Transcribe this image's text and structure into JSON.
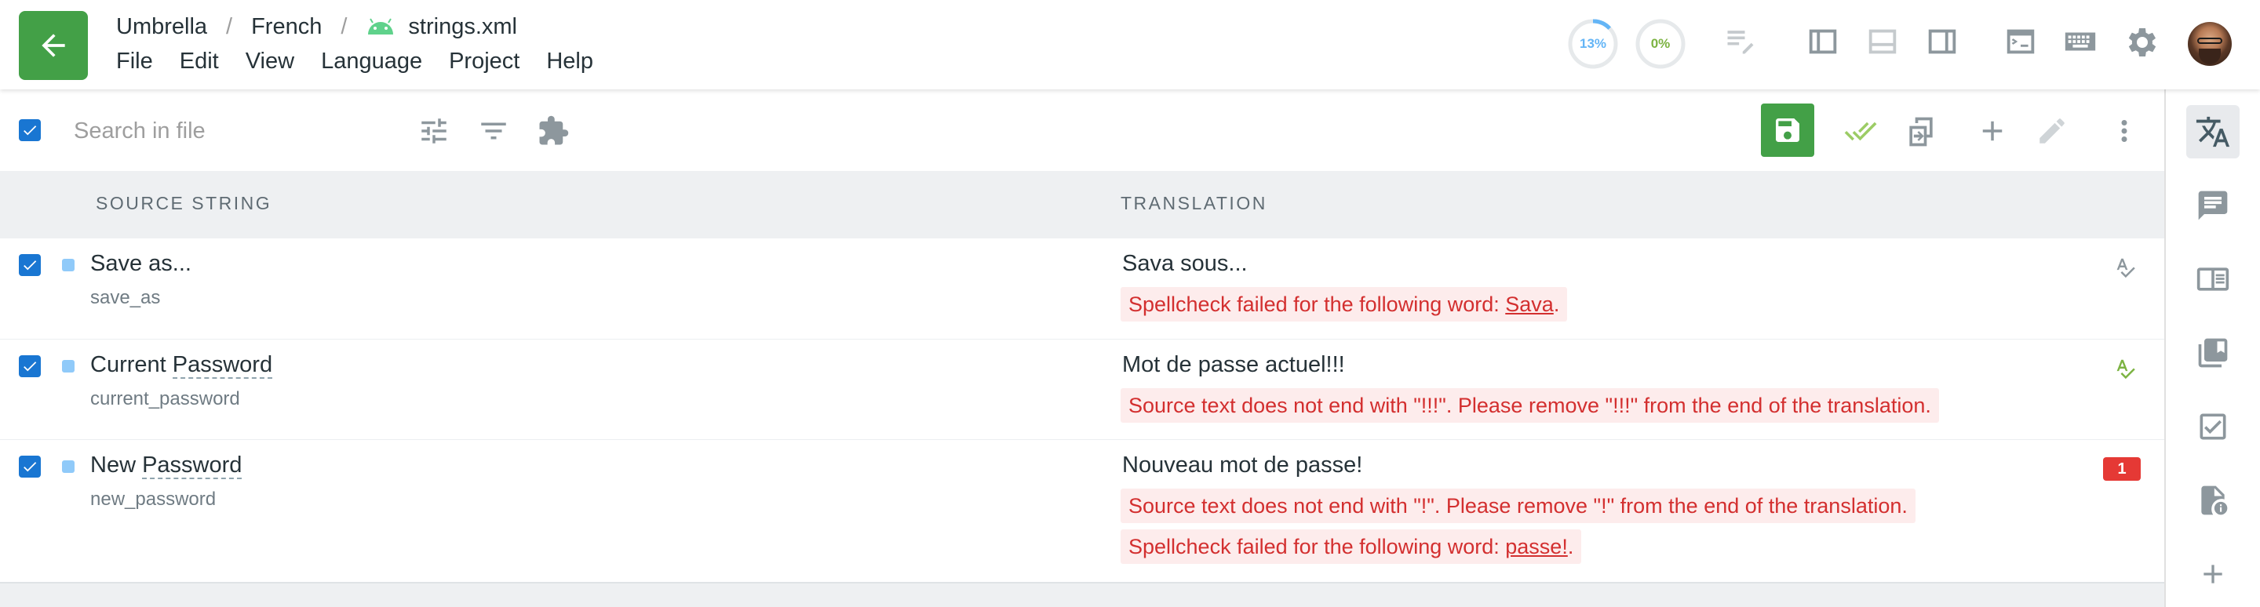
{
  "breadcrumb": {
    "project": "Umbrella",
    "language": "French",
    "separator": "/",
    "file": "strings.xml"
  },
  "menu": [
    "File",
    "Edit",
    "View",
    "Language",
    "Project",
    "Help"
  ],
  "progress": {
    "translated": "13%",
    "approved": "0%",
    "translated_value": 0.13,
    "approved_value": 0
  },
  "search": {
    "placeholder": "Search in file"
  },
  "columns": {
    "source": "SOURCE STRING",
    "translation": "TRANSLATION"
  },
  "rows": [
    {
      "source_prefix": "Save as...",
      "source_underlined": "",
      "key": "save_as",
      "translation": "Sava sous...",
      "errors": [
        {
          "text": "Spellcheck failed for the following word: ",
          "word": "Sava",
          "suffix": "."
        }
      ]
    },
    {
      "source_prefix": "Current ",
      "source_underlined": "Password",
      "key": "current_password",
      "translation": "Mot de passe actuel!!!",
      "errors": [
        {
          "text": "Source text does not end with \"!!!\". Please remove \"!!!\" from the end of the translation.",
          "word": "",
          "suffix": ""
        }
      ]
    },
    {
      "source_prefix": "New ",
      "source_underlined": "Password",
      "key": "new_password",
      "translation": "Nouveau mot de passe!",
      "badge": "1",
      "errors": [
        {
          "text": "Source text does not end with \"!\". Please remove \"!\" from the end of the translation.",
          "word": "",
          "suffix": ""
        },
        {
          "text": "Spellcheck failed for the following word: ",
          "word": "passe!",
          "suffix": "."
        }
      ]
    }
  ],
  "colors": {
    "primary_green": "#43a047",
    "checkbox_blue": "#1976d2",
    "error_red": "#d32f2f",
    "error_bg": "#fdecec",
    "spellcheck_ok": "#7cb342"
  },
  "icons": {
    "topbar": [
      "back-arrow-icon",
      "android-icon",
      "edit-notes-icon",
      "layout-left-panel-icon",
      "layout-bottom-panel-icon",
      "layout-right-panel-icon",
      "terminal-icon",
      "keyboard-icon",
      "gear-icon"
    ],
    "toolbar": [
      "tune-icon",
      "filter-icon",
      "extension-icon",
      "save-icon",
      "double-check-icon",
      "copy-source-icon",
      "add-icon",
      "pencil-icon",
      "more-vertical-icon"
    ],
    "rightbar": [
      "translate-icon",
      "comment-icon",
      "dictionary-icon",
      "translation-memory-icon",
      "qa-checklist-icon",
      "file-info-icon",
      "add-icon"
    ]
  }
}
